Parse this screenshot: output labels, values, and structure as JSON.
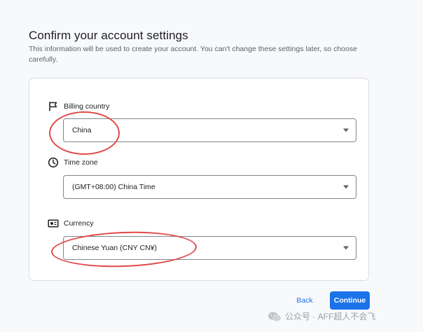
{
  "page": {
    "title": "Confirm your account settings",
    "description": "This information will be used to create your account. You can't change these settings later, so choose carefully."
  },
  "fields": {
    "billing_country": {
      "label": "Billing country",
      "value": "China",
      "icon": "flag-icon"
    },
    "time_zone": {
      "label": "Time zone",
      "value": "(GMT+08:00) China Time",
      "icon": "clock-icon"
    },
    "currency": {
      "label": "Currency",
      "value": "Chinese Yuan (CNY CN¥)",
      "icon": "currency-icon"
    }
  },
  "actions": {
    "back_label": "Back",
    "continue_label": "Continue"
  },
  "watermark": {
    "text": "公众号 · AFF超人不会飞"
  },
  "colors": {
    "accent": "#1a73e8",
    "annotation": "#e04848",
    "background": "#f8f9fa"
  }
}
